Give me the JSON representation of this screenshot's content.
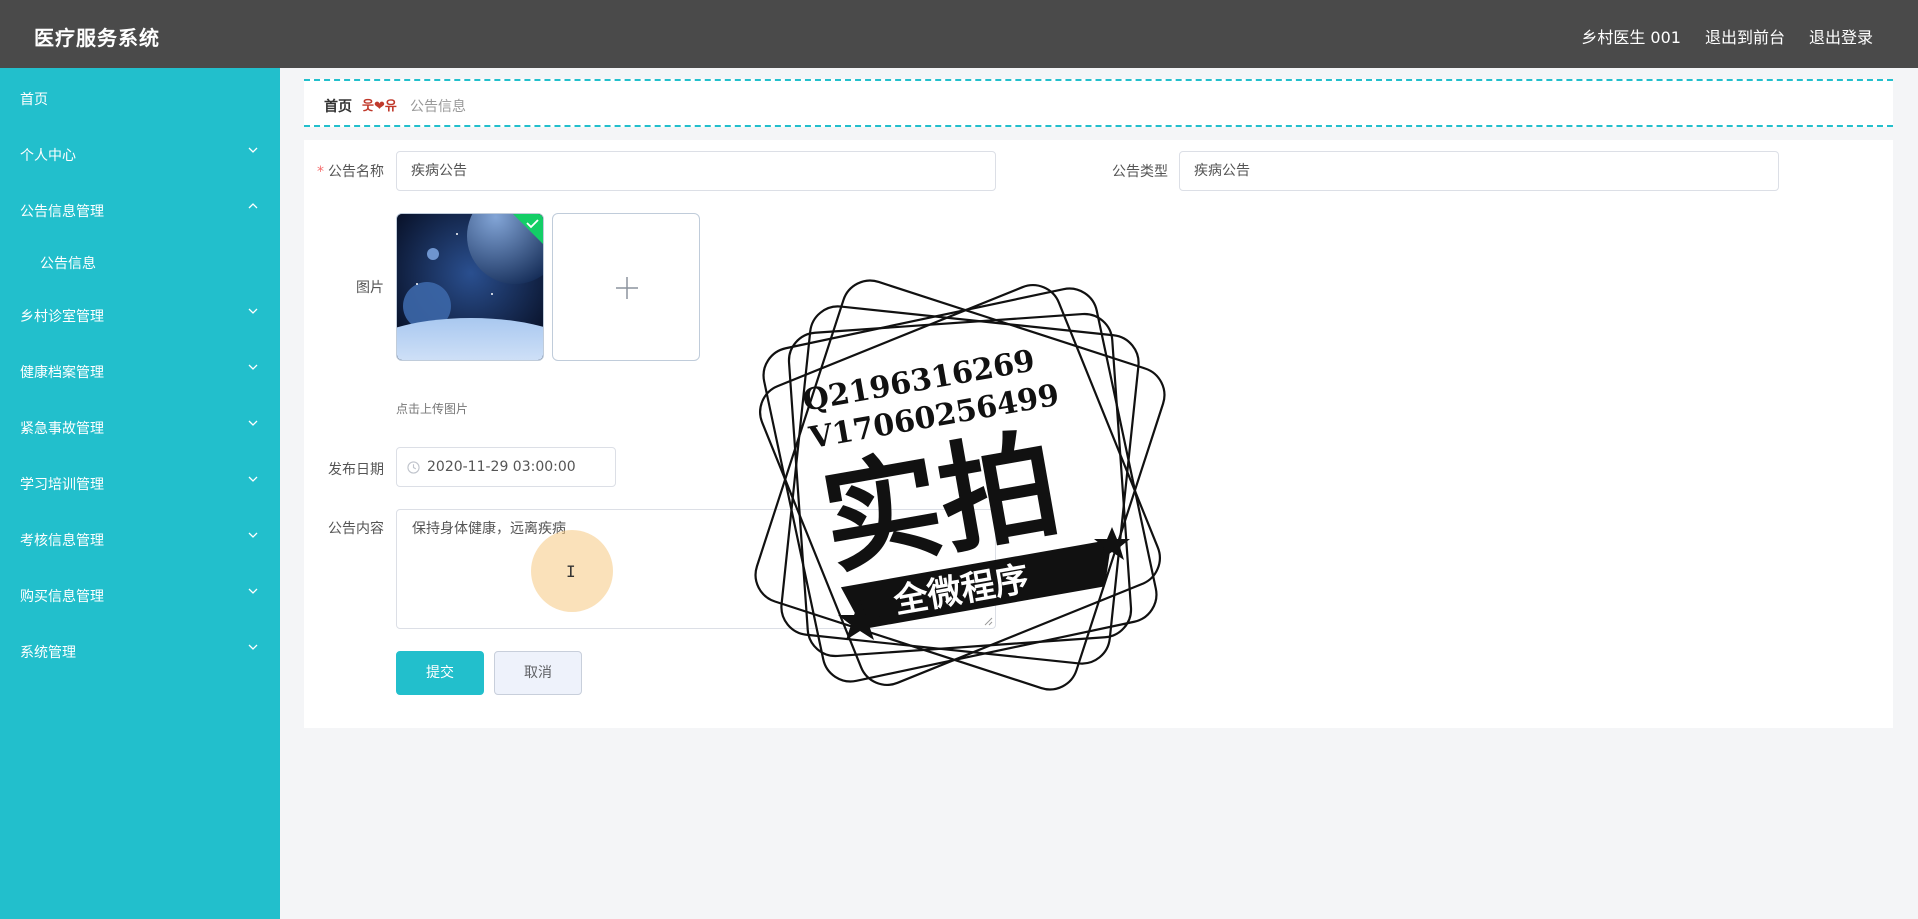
{
  "header": {
    "app_title": "医疗服务系统",
    "user": "乡村医生 001",
    "to_front": "退出到前台",
    "logout": "退出登录"
  },
  "sidebar": {
    "items": [
      {
        "label": "首页",
        "chevron": "none"
      },
      {
        "label": "个人中心",
        "chevron": "down"
      },
      {
        "label": "公告信息管理",
        "chevron": "up"
      },
      {
        "label": "公告信息",
        "chevron": "none"
      },
      {
        "label": "乡村诊室管理",
        "chevron": "down"
      },
      {
        "label": "健康档案管理",
        "chevron": "down"
      },
      {
        "label": "紧急事故管理",
        "chevron": "down"
      },
      {
        "label": "学习培训管理",
        "chevron": "down"
      },
      {
        "label": "考核信息管理",
        "chevron": "down"
      },
      {
        "label": "购买信息管理",
        "chevron": "down"
      },
      {
        "label": "系统管理",
        "chevron": "down"
      }
    ]
  },
  "breadcrumb": {
    "home": "首页",
    "separator": "웃❤유",
    "current": "公告信息"
  },
  "form": {
    "name_required_mark": "*",
    "name_label": "公告名称",
    "name_value": "疾病公告",
    "type_label": "公告类型",
    "type_value": "疾病公告",
    "image_label": "图片",
    "upload_hint": "点击上传图片",
    "date_label": "发布日期",
    "date_value": "2020-11-29 03:00:00",
    "content_label": "公告内容",
    "content_value": "保持身体健康，远离疾病",
    "submit_label": "提交",
    "cancel_label": "取消"
  },
  "watermark": {
    "line1": "Q2196316269",
    "line2": "V17060256499",
    "main": "实拍",
    "banner": "全微程序"
  },
  "colors": {
    "accent": "#22bfcc",
    "topbar": "#4a4a4a",
    "success": "#13ce66"
  }
}
